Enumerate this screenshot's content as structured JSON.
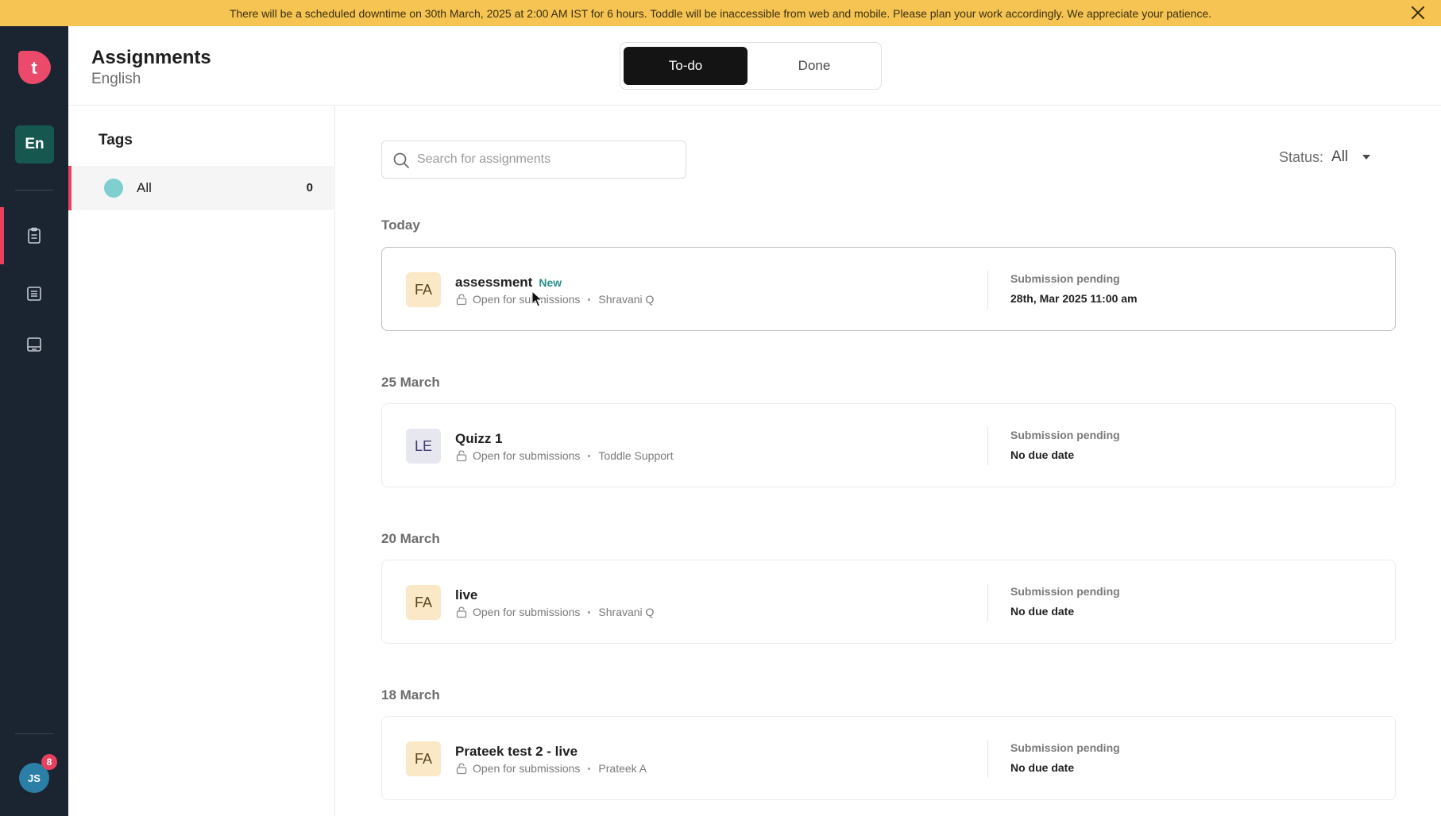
{
  "banner": {
    "message": "There will be a scheduled downtime on 30th March, 2025 at 2:00 AM IST for 6 hours. Toddle will be inaccessible from web and mobile. Please plan your work accordingly. We appreciate your patience.",
    "close_icon": "close-icon"
  },
  "rail": {
    "logo_letter": "t",
    "course_chip": "En",
    "items": [
      {
        "icon": "clipboard-icon",
        "active": true
      },
      {
        "icon": "list-document-icon",
        "active": false
      },
      {
        "icon": "notebook-icon",
        "active": false
      }
    ],
    "avatar_initials": "JS",
    "notification_count": "8"
  },
  "header": {
    "title": "Assignments",
    "subtitle": "English",
    "tabs": [
      {
        "label": "To-do",
        "selected": true
      },
      {
        "label": "Done",
        "selected": false
      }
    ]
  },
  "tags": {
    "title": "Tags",
    "items": [
      {
        "label": "All",
        "count": "0",
        "color": "#7fcfd0"
      }
    ]
  },
  "search": {
    "placeholder": "Search for assignments",
    "value": ""
  },
  "status_filter": {
    "label": "Status:",
    "value": "All"
  },
  "groups": [
    {
      "label": "Today",
      "cards": [
        {
          "initials": "FA",
          "title": "assessment",
          "badge": "New",
          "state": "Open for submissions",
          "author": "Shravani Q",
          "status": "Submission pending",
          "due": "28th, Mar 2025 11:00 am"
        }
      ]
    },
    {
      "label": "25 March",
      "cards": [
        {
          "initials": "LE",
          "title": "Quizz 1",
          "badge": "",
          "state": "Open for submissions",
          "author": "Toddle Support",
          "status": "Submission pending",
          "due": "No due date"
        }
      ]
    },
    {
      "label": "20 March",
      "cards": [
        {
          "initials": "FA",
          "title": "live",
          "badge": "",
          "state": "Open for submissions",
          "author": "Shravani Q",
          "status": "Submission pending",
          "due": "No due date"
        }
      ]
    },
    {
      "label": "18 March",
      "cards": [
        {
          "initials": "FA",
          "title": "Prateek test 2 - live",
          "badge": "",
          "state": "Open for submissions",
          "author": "Prateek A",
          "status": "Submission pending",
          "due": "No due date"
        }
      ]
    }
  ],
  "colors": {
    "accent": "#e8405f",
    "rail_bg": "#1b2431",
    "banner_bg": "#f6c453",
    "course_chip_bg": "#16584f",
    "new_badge": "#2a8f89"
  }
}
